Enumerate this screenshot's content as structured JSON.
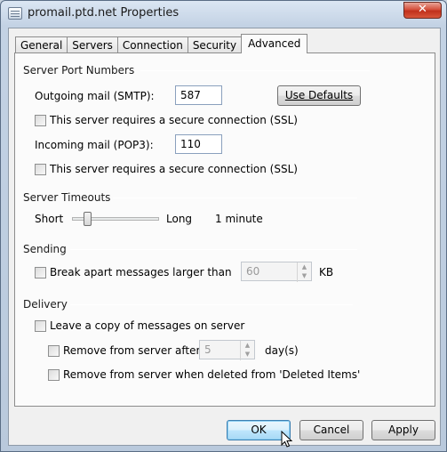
{
  "window": {
    "title": "promail.ptd.net Properties",
    "close_glyph": "✕"
  },
  "tabs": [
    {
      "label": "General"
    },
    {
      "label": "Servers"
    },
    {
      "label": "Connection"
    },
    {
      "label": "Security"
    },
    {
      "label": "Advanced",
      "active": true
    }
  ],
  "server_ports": {
    "group_title": "Server Port Numbers",
    "outgoing_label": "Outgoing mail (SMTP):",
    "outgoing_value": "587",
    "use_defaults_label": "Use Defaults",
    "ssl_outgoing_label": "This server requires a secure connection (SSL)",
    "ssl_outgoing_checked": false,
    "incoming_label": "Incoming mail (POP3):",
    "incoming_value": "110",
    "ssl_incoming_label": "This server requires a secure connection (SSL)",
    "ssl_incoming_checked": false
  },
  "timeouts": {
    "group_title": "Server Timeouts",
    "short_label": "Short",
    "long_label": "Long",
    "value_label": "1 minute",
    "slider_level": 0.15
  },
  "sending": {
    "group_title": "Sending",
    "break_label": "Break apart messages larger than",
    "break_checked": false,
    "break_value": "60",
    "unit": "KB"
  },
  "delivery": {
    "group_title": "Delivery",
    "leave_copy_label": "Leave a copy of messages on server",
    "leave_copy_checked": false,
    "remove_after_label": "Remove from server after",
    "remove_after_value": "5",
    "days_label": "day(s)",
    "remove_deleted_label": "Remove from server when deleted from 'Deleted Items'"
  },
  "buttons": {
    "ok": "OK",
    "cancel": "Cancel",
    "apply": "Apply"
  },
  "icons": {
    "window": "properties-window-icon",
    "close": "close-icon",
    "spin_up": "spin-up-icon",
    "spin_down": "spin-down-icon",
    "cursor": "mouse-pointer-icon"
  }
}
